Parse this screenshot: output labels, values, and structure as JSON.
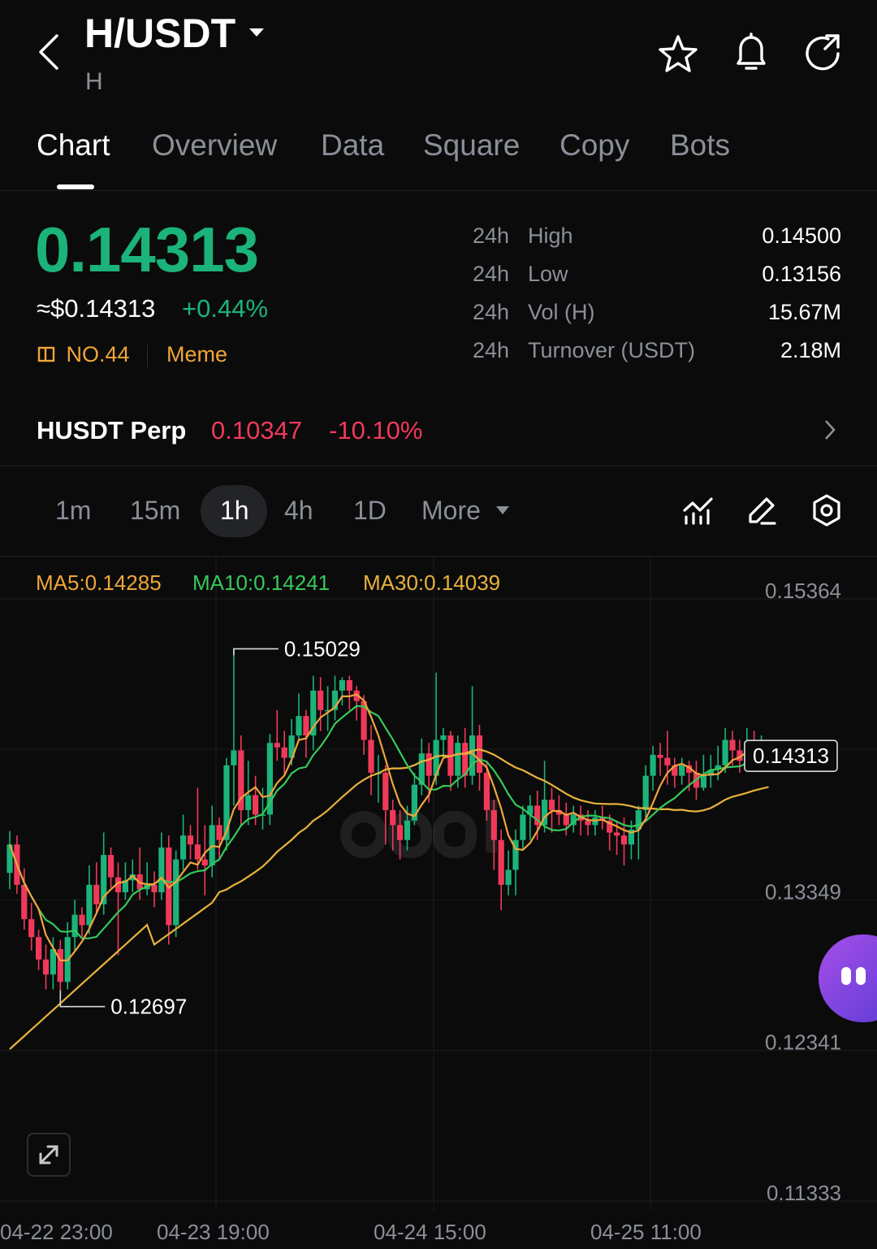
{
  "header": {
    "pair": "H/USDT",
    "subtitle": "H"
  },
  "icons": {
    "back": "chevron-left-icon",
    "pair_dropdown": "caret-down-icon",
    "favorite": "star-icon",
    "alert": "bell-icon",
    "share": "share-icon"
  },
  "tabs": [
    {
      "label": "Chart",
      "active": true
    },
    {
      "label": "Overview",
      "active": false
    },
    {
      "label": "Data",
      "active": false
    },
    {
      "label": "Square",
      "active": false
    },
    {
      "label": "Copy",
      "active": false
    },
    {
      "label": "Bots",
      "active": false
    }
  ],
  "price": {
    "last": "0.14313",
    "usd": "≈$0.14313",
    "change": "+0.44%",
    "rank": "NO.44",
    "category": "Meme"
  },
  "stats": [
    {
      "period": "24h",
      "label": "High",
      "value": "0.14500"
    },
    {
      "period": "24h",
      "label": "Low",
      "value": "0.13156"
    },
    {
      "period": "24h",
      "label": "Vol (H)",
      "value": "15.67M"
    },
    {
      "period": "24h",
      "label": "Turnover (USDT)",
      "value": "2.18M"
    }
  ],
  "perp": {
    "name": "HUSDT Perp",
    "price": "0.10347",
    "change": "-10.10%"
  },
  "timeframes": [
    {
      "label": "1m",
      "active": false
    },
    {
      "label": "15m",
      "active": false
    },
    {
      "label": "1h",
      "active": true
    },
    {
      "label": "4h",
      "active": false
    },
    {
      "label": "1D",
      "active": false
    }
  ],
  "more_label": "More",
  "colors": {
    "up": "#1bb37a",
    "down": "#f0395a",
    "ma5": "#f0a53a",
    "ma10": "#35c95a",
    "ma30": "#e8b23c",
    "accent_orange": "#f0a53a",
    "background": "#0b0b0b"
  },
  "chart_data": {
    "type": "candlestick",
    "interval": "1h",
    "indicators": [
      {
        "name": "MA5",
        "value": "MA5:0.14285"
      },
      {
        "name": "MA10",
        "value": "MA10:0.14241"
      },
      {
        "name": "MA30",
        "value": "MA30:0.14039"
      }
    ],
    "y_ticks": [
      "0.15364",
      "0.13349",
      "0.12341",
      "0.11333"
    ],
    "ylim": [
      0.11333,
      0.15364
    ],
    "x_ticks": [
      "04-22 23:00",
      "04-23 19:00",
      "04-24 15:00",
      "04-25 11:00"
    ],
    "high_marker": "0.15029",
    "low_marker": "0.12697",
    "last_price_tag": "0.14313",
    "candles": [
      [
        0.1353,
        0.1372,
        0.1381,
        0.1342
      ],
      [
        0.1372,
        0.1345,
        0.1378,
        0.1339
      ],
      [
        0.1345,
        0.1322,
        0.1356,
        0.1315
      ],
      [
        0.1322,
        0.131,
        0.1333,
        0.1301
      ],
      [
        0.131,
        0.1295,
        0.1315,
        0.1288
      ],
      [
        0.1295,
        0.1285,
        0.1305,
        0.1275
      ],
      [
        0.1285,
        0.1302,
        0.131,
        0.1275
      ],
      [
        0.1302,
        0.128,
        0.1308,
        0.127
      ],
      [
        0.128,
        0.131,
        0.132,
        0.1275
      ],
      [
        0.131,
        0.1325,
        0.1335,
        0.13
      ],
      [
        0.1325,
        0.1318,
        0.133,
        0.131
      ],
      [
        0.1318,
        0.1345,
        0.1358,
        0.1312
      ],
      [
        0.1345,
        0.1332,
        0.136,
        0.1325
      ],
      [
        0.1332,
        0.1365,
        0.138,
        0.1325
      ],
      [
        0.1365,
        0.135,
        0.137,
        0.1343
      ],
      [
        0.135,
        0.134,
        0.136,
        0.1298
      ],
      [
        0.134,
        0.1348,
        0.136,
        0.1335
      ],
      [
        0.1348,
        0.1352,
        0.1362,
        0.134
      ],
      [
        0.1352,
        0.1342,
        0.137,
        0.1335
      ],
      [
        0.1342,
        0.1345,
        0.136,
        0.1338
      ],
      [
        0.1345,
        0.134,
        0.1354,
        0.133
      ],
      [
        0.134,
        0.137,
        0.138,
        0.1335
      ],
      [
        0.137,
        0.1318,
        0.1378,
        0.1305
      ],
      [
        0.1318,
        0.1362,
        0.1368,
        0.131
      ],
      [
        0.1362,
        0.1378,
        0.1392,
        0.1355
      ],
      [
        0.1378,
        0.1372,
        0.1385,
        0.1362
      ],
      [
        0.1372,
        0.1362,
        0.141,
        0.1355
      ],
      [
        0.1362,
        0.1358,
        0.1385,
        0.1338
      ],
      [
        0.1358,
        0.1385,
        0.1398,
        0.135
      ],
      [
        0.1385,
        0.1375,
        0.139,
        0.1362
      ],
      [
        0.1375,
        0.1425,
        0.143,
        0.1368
      ],
      [
        0.1425,
        0.1435,
        0.1503,
        0.1398
      ],
      [
        0.1435,
        0.1395,
        0.1445,
        0.1385
      ],
      [
        0.1395,
        0.1405,
        0.1428,
        0.1385
      ],
      [
        0.1405,
        0.1392,
        0.1418,
        0.1385
      ],
      [
        0.1392,
        0.1392,
        0.141,
        0.1382
      ],
      [
        0.1392,
        0.144,
        0.1446,
        0.1385
      ],
      [
        0.144,
        0.1437,
        0.1462,
        0.1428
      ],
      [
        0.1437,
        0.143,
        0.1448,
        0.1418
      ],
      [
        0.143,
        0.1445,
        0.1456,
        0.1425
      ],
      [
        0.1445,
        0.1458,
        0.1473,
        0.1442
      ],
      [
        0.1458,
        0.1445,
        0.1462,
        0.143
      ],
      [
        0.1445,
        0.1475,
        0.1485,
        0.1435
      ],
      [
        0.1475,
        0.1462,
        0.1484,
        0.1448
      ],
      [
        0.1462,
        0.1462,
        0.1478,
        0.1448
      ],
      [
        0.1462,
        0.1475,
        0.1485,
        0.1455
      ],
      [
        0.1475,
        0.1482,
        0.1484,
        0.1465
      ],
      [
        0.1482,
        0.1475,
        0.1485,
        0.1462
      ],
      [
        0.1475,
        0.1468,
        0.1478,
        0.1455
      ],
      [
        0.1468,
        0.1442,
        0.1472,
        0.1432
      ],
      [
        0.1442,
        0.142,
        0.1452,
        0.1405
      ],
      [
        0.142,
        0.142,
        0.1432,
        0.14
      ],
      [
        0.142,
        0.1395,
        0.1425,
        0.1372
      ],
      [
        0.1395,
        0.1385,
        0.1402,
        0.1368
      ],
      [
        0.1385,
        0.1375,
        0.1395,
        0.1362
      ],
      [
        0.1375,
        0.1388,
        0.1398,
        0.1368
      ],
      [
        0.1388,
        0.1412,
        0.142,
        0.1385
      ],
      [
        0.1412,
        0.1433,
        0.1443,
        0.1405
      ],
      [
        0.1433,
        0.1418,
        0.144,
        0.14
      ],
      [
        0.1418,
        0.1442,
        0.1487,
        0.1412
      ],
      [
        0.1442,
        0.1445,
        0.145,
        0.143
      ],
      [
        0.1445,
        0.1418,
        0.1448,
        0.1408
      ],
      [
        0.1418,
        0.144,
        0.1445,
        0.141
      ],
      [
        0.144,
        0.1418,
        0.145,
        0.141
      ],
      [
        0.1418,
        0.1445,
        0.1478,
        0.1412
      ],
      [
        0.1445,
        0.142,
        0.1452,
        0.1408
      ],
      [
        0.142,
        0.1395,
        0.1428,
        0.1388
      ],
      [
        0.1395,
        0.1375,
        0.1402,
        0.1355
      ],
      [
        0.1375,
        0.1345,
        0.1382,
        0.1328
      ],
      [
        0.1345,
        0.1355,
        0.1368,
        0.1338
      ],
      [
        0.1355,
        0.1375,
        0.1382,
        0.1338
      ],
      [
        0.1375,
        0.1392,
        0.1398,
        0.1368
      ],
      [
        0.1392,
        0.1398,
        0.1405,
        0.1375
      ],
      [
        0.1398,
        0.1385,
        0.1408,
        0.1375
      ],
      [
        0.1385,
        0.1402,
        0.1428,
        0.138
      ],
      [
        0.1402,
        0.1395,
        0.141,
        0.138
      ],
      [
        0.1395,
        0.1392,
        0.1405,
        0.1385
      ],
      [
        0.1392,
        0.1385,
        0.14,
        0.1378
      ],
      [
        0.1385,
        0.1392,
        0.1398,
        0.138
      ],
      [
        0.1392,
        0.1388,
        0.1398,
        0.1378
      ],
      [
        0.1388,
        0.1385,
        0.1395,
        0.1378
      ],
      [
        0.1385,
        0.139,
        0.1395,
        0.1378
      ],
      [
        0.139,
        0.1388,
        0.1398,
        0.1382
      ],
      [
        0.1388,
        0.138,
        0.1392,
        0.1368
      ],
      [
        0.138,
        0.1378,
        0.1388,
        0.1365
      ],
      [
        0.1378,
        0.1372,
        0.139,
        0.1358
      ],
      [
        0.1372,
        0.1382,
        0.1388,
        0.1362
      ],
      [
        0.1382,
        0.1395,
        0.1398,
        0.1362
      ],
      [
        0.1395,
        0.1418,
        0.1425,
        0.139
      ],
      [
        0.1418,
        0.1432,
        0.1438,
        0.1408
      ],
      [
        0.1432,
        0.143,
        0.144,
        0.1418
      ],
      [
        0.143,
        0.1425,
        0.1448,
        0.1412
      ],
      [
        0.1425,
        0.1418,
        0.143,
        0.141
      ],
      [
        0.1418,
        0.1425,
        0.143,
        0.1412
      ],
      [
        0.1425,
        0.142,
        0.1428,
        0.1408
      ],
      [
        0.142,
        0.141,
        0.1428,
        0.1402
      ],
      [
        0.141,
        0.1418,
        0.1432,
        0.1408
      ],
      [
        0.1418,
        0.1422,
        0.1432,
        0.141
      ],
      [
        0.1422,
        0.1425,
        0.1438,
        0.1415
      ],
      [
        0.1425,
        0.1442,
        0.145,
        0.142
      ],
      [
        0.1442,
        0.1435,
        0.1448,
        0.1425
      ],
      [
        0.1435,
        0.1428,
        0.1442,
        0.142
      ],
      [
        0.1428,
        0.144,
        0.145,
        0.1422
      ],
      [
        0.144,
        0.1432,
        0.1448,
        0.1425
      ],
      [
        0.1432,
        0.1438,
        0.1445,
        0.1425
      ],
      [
        0.1438,
        0.1431,
        0.1442,
        0.1425
      ]
    ]
  }
}
